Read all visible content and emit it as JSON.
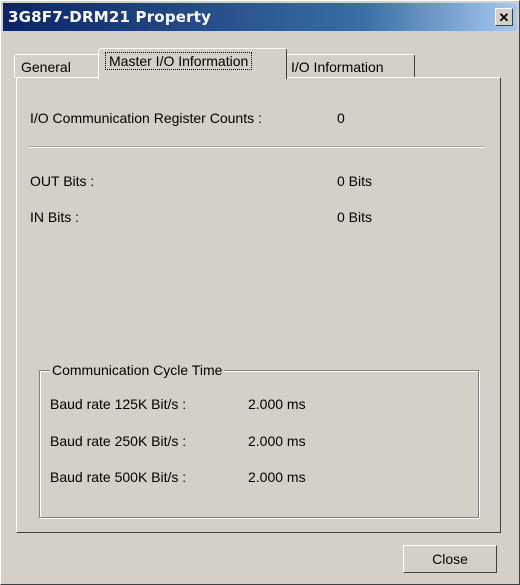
{
  "window": {
    "title": "3G8F7-DRM21 Property",
    "close_glyph": "✕"
  },
  "tabs": [
    {
      "label": "General",
      "active": false
    },
    {
      "label": "Master I/O Information",
      "active": true
    },
    {
      "label": "I/O Information",
      "active": false
    }
  ],
  "io": {
    "register_counts_label": "I/O Communication Register Counts :",
    "register_counts_value": "0",
    "out_bits_label": "OUT Bits :",
    "out_bits_value": "0 Bits",
    "in_bits_label": "IN Bits :",
    "in_bits_value": "0 Bits"
  },
  "cycle": {
    "title": "Communication Cycle Time",
    "rows": [
      {
        "label": "Baud rate 125K Bit/s :",
        "value": "2.000 ms"
      },
      {
        "label": "Baud rate 250K Bit/s :",
        "value": "2.000 ms"
      },
      {
        "label": "Baud rate 500K Bit/s :",
        "value": "2.000 ms"
      }
    ]
  },
  "buttons": {
    "close": "Close"
  }
}
